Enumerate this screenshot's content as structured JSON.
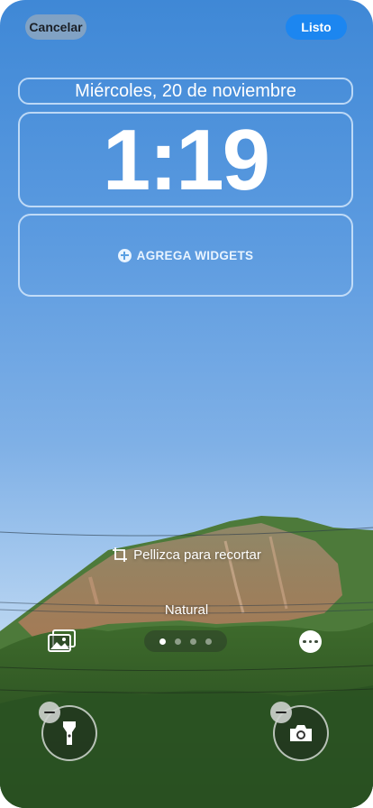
{
  "topbar": {
    "cancel_label": "Cancelar",
    "done_label": "Listo"
  },
  "lockscreen": {
    "date": "Miércoles, 20 de noviembre",
    "time": "1:19",
    "widgets_label": "AGREGA WIDGETS"
  },
  "editor": {
    "pinch_hint": "Pellizca para recortar",
    "filter_name": "Natural",
    "page_dots": {
      "count": 4,
      "active": 1
    }
  },
  "quick_actions": {
    "left_icon": "flashlight-icon",
    "right_icon": "camera-icon"
  },
  "colors": {
    "accent": "#1c86f0",
    "sky_top": "#3f88d6",
    "sky_bottom": "#b9d5f1",
    "foliage": "#2f5a26"
  }
}
